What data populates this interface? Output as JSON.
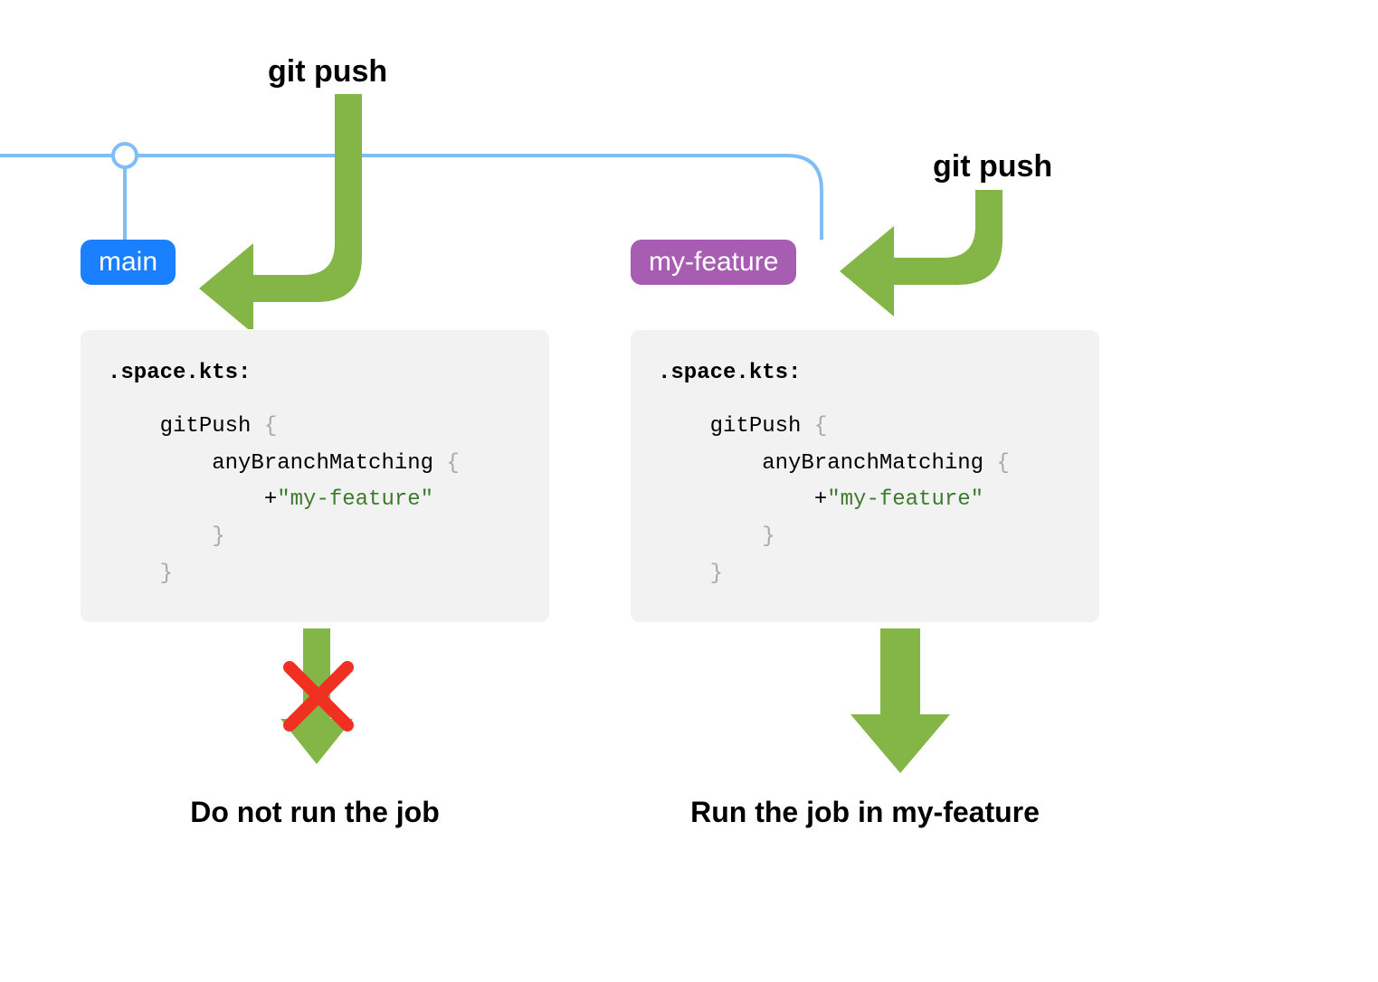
{
  "labels": {
    "git_push_left": "git push",
    "git_push_right": "git push",
    "branch_main": "main",
    "branch_feature": "my-feature",
    "caption_left": "Do not run the job",
    "caption_right": "Run the job in my-feature"
  },
  "code": {
    "filename": ".space.kts:",
    "line1_a": "gitPush ",
    "line1_b": "{",
    "line2_a": "anyBranchMatching ",
    "line2_b": "{",
    "line3_a": "+",
    "line3_b": "\"my-feature\"",
    "line4": "}",
    "line5": "}"
  },
  "colors": {
    "arrow_green": "#84b547",
    "branch_line": "#81bdf5",
    "main_bg": "#1a80ff",
    "feature_bg": "#a65db2",
    "cross_red": "#f03020",
    "code_string": "#3d7a2f",
    "code_brace": "#a9a9a9"
  }
}
